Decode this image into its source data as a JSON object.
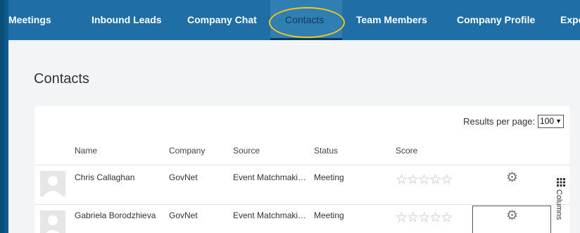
{
  "nav": {
    "tabs": [
      {
        "label": "Meetings",
        "active": false
      },
      {
        "label": "Inbound Leads",
        "active": false
      },
      {
        "label": "Company Chat",
        "active": false
      },
      {
        "label": "Contacts",
        "active": true
      },
      {
        "label": "Team Members",
        "active": false
      },
      {
        "label": "Company Profile",
        "active": false
      },
      {
        "label": "Expo",
        "active": false
      }
    ]
  },
  "page": {
    "title": "Contacts"
  },
  "results_per_page": {
    "label": "Results per page:",
    "value": "100"
  },
  "table": {
    "headers": {
      "name": "Name",
      "company": "Company",
      "source": "Source",
      "status": "Status",
      "score": "Score"
    },
    "rows": [
      {
        "name": "Chris Callaghan",
        "company": "GovNet",
        "source": "Event Matchmaki…",
        "status": "Meeting",
        "score": 0
      },
      {
        "name": "Gabriela Borodzhieva",
        "company": "GovNet",
        "source": "Event Matchmaki…",
        "status": "Meeting",
        "score": 0
      }
    ]
  },
  "columns_toggle": {
    "label": "Columns"
  },
  "colors": {
    "nav_bg": "#1f6fa6",
    "highlight": "#f5c518",
    "page_bg": "#f3f4f6"
  }
}
